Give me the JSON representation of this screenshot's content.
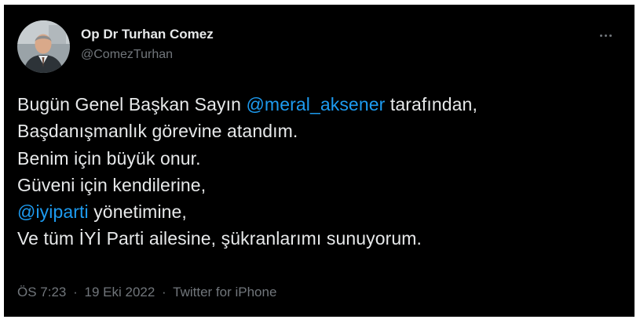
{
  "author": {
    "display_name": "Op Dr Turhan Comez",
    "handle": "@ComezTurhan"
  },
  "more_icon": "more-dots-icon",
  "tweet": {
    "lines": [
      [
        "Bugün Genel Başkan Sayın ",
        "@meral_aksener",
        " tarafından,"
      ],
      [
        "Başdanışmanlık görevine atandım."
      ],
      [
        "Benim için büyük onur."
      ],
      [
        "Güveni için kendilerine,"
      ],
      [
        "",
        "@iyiparti",
        " yönetimine,"
      ],
      [
        "Ve tüm İYİ Parti ailesine, şükranlarımı sunuyorum."
      ]
    ]
  },
  "meta": {
    "time": "ÖS 7:23",
    "separator": "·",
    "date": "19 Eki 2022",
    "source": "Twitter for iPhone"
  },
  "colors": {
    "background": "#000000",
    "text": "#e7e9ea",
    "secondary": "#71767b",
    "mention": "#1d9bf0"
  }
}
